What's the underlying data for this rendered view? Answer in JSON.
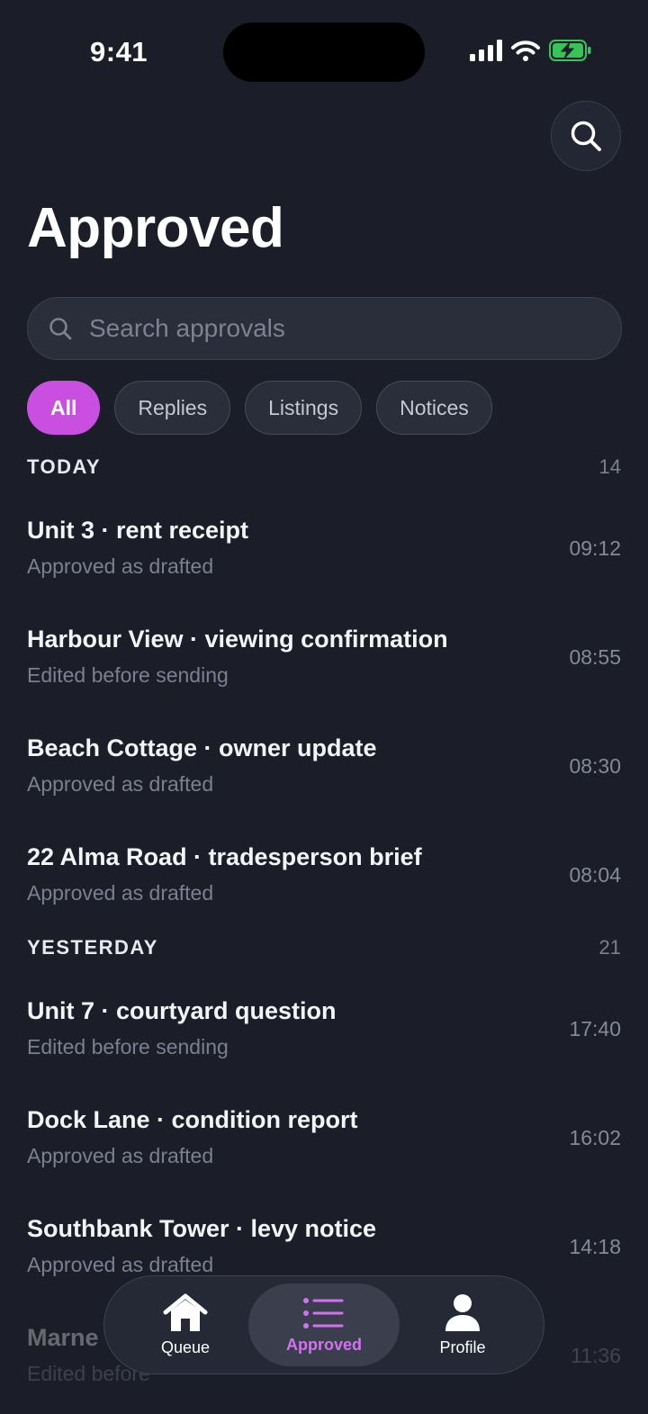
{
  "status": {
    "time": "9:41"
  },
  "title": "Approved",
  "search": {
    "placeholder": "Search approvals"
  },
  "filters": [
    {
      "label": "All",
      "active": true
    },
    {
      "label": "Replies",
      "active": false
    },
    {
      "label": "Listings",
      "active": false
    },
    {
      "label": "Notices",
      "active": false
    }
  ],
  "sections": [
    {
      "title": "TODAY",
      "count": "14",
      "items": [
        {
          "title": "Unit 3 · rent receipt",
          "subtitle": "Approved as drafted",
          "time": "09:12"
        },
        {
          "title": "Harbour View · viewing confirmation",
          "subtitle": "Edited before sending",
          "time": "08:55"
        },
        {
          "title": "Beach Cottage · owner update",
          "subtitle": "Approved as drafted",
          "time": "08:30"
        },
        {
          "title": "22 Alma Road · tradesperson brief",
          "subtitle": "Approved as drafted",
          "time": "08:04"
        }
      ]
    },
    {
      "title": "YESTERDAY",
      "count": "21",
      "items": [
        {
          "title": "Unit 7 · courtyard question",
          "subtitle": "Edited before sending",
          "time": "17:40"
        },
        {
          "title": "Dock Lane · condition report",
          "subtitle": "Approved as drafted",
          "time": "16:02"
        },
        {
          "title": "Southbank Tower · levy notice",
          "subtitle": "Approved as drafted",
          "time": "14:18"
        },
        {
          "title": "Marne",
          "subtitle": "Edited before",
          "time": "11:36"
        }
      ]
    }
  ],
  "tabbar": [
    {
      "label": "Queue",
      "icon": "house-icon"
    },
    {
      "label": "Approved",
      "icon": "list-icon"
    },
    {
      "label": "Profile",
      "icon": "person-icon"
    }
  ],
  "colors": {
    "background": "#1b1e29",
    "accent": "#c94fe0",
    "tab_active": "#d372ee",
    "battery": "#39c45a"
  }
}
